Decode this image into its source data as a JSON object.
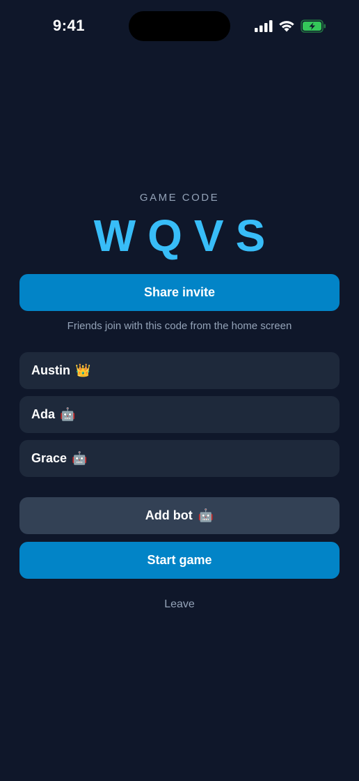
{
  "status_bar": {
    "time": "9:41",
    "battery_color": "#34c759"
  },
  "lobby": {
    "code_label": "GAME CODE",
    "code": "WQVS",
    "code_color": "#38bdf8",
    "share_label": "Share invite",
    "hint": "Friends join with this code from the home screen",
    "players": [
      {
        "name": "Austin",
        "badge": "👑",
        "badge_icon": "crown-icon"
      },
      {
        "name": "Ada",
        "badge": "🤖",
        "badge_icon": "robot-icon"
      },
      {
        "name": "Grace",
        "badge": "🤖",
        "badge_icon": "robot-icon"
      }
    ],
    "add_bot_label": "Add bot",
    "add_bot_icon": "robot-icon",
    "start_label": "Start game",
    "leave_label": "Leave",
    "accent_color": "#0284c7"
  }
}
